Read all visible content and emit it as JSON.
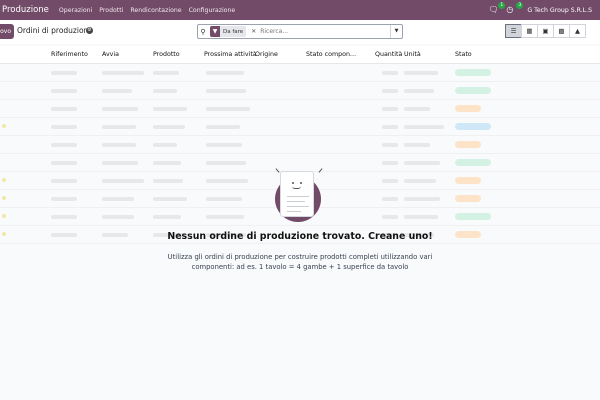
{
  "navbar": {
    "app_title": "Produzione",
    "menu": [
      "Operazioni",
      "Prodotti",
      "Rendicontazione",
      "Configurazione"
    ],
    "messages_badge": "1",
    "activities_badge": "3",
    "company": "G Tech Group S.R.L.S",
    "accent_color": "#714b67"
  },
  "control": {
    "new_button": "Nuovo",
    "breadcrumb": "Ordini di produzione",
    "search": {
      "facet_label": "Da fare",
      "placeholder": "Ricerca..."
    },
    "views": [
      {
        "name": "list",
        "icon": "list-icon",
        "active": true
      },
      {
        "name": "kanban",
        "icon": "kanban-icon",
        "active": false
      },
      {
        "name": "calendar",
        "icon": "calendar-icon",
        "active": false
      },
      {
        "name": "pivot",
        "icon": "pivot-icon",
        "active": false
      },
      {
        "name": "graph",
        "icon": "graph-icon",
        "active": false
      }
    ]
  },
  "table": {
    "columns": [
      "Riferimento",
      "Avvia",
      "Prodotto",
      "Prossima attività",
      "Origine",
      "Stato compon…",
      "Quantità",
      "Unità",
      "Stato"
    ]
  },
  "empty_state": {
    "title": "Nessun ordine di produzione trovato. Creane uno!",
    "text": "Utilizza gli ordini di produzione per costruire prodotti completi utilizzando vari componenti: ad es. 1 tavolo = 4 gambe + 1 superfice da tavolo"
  }
}
